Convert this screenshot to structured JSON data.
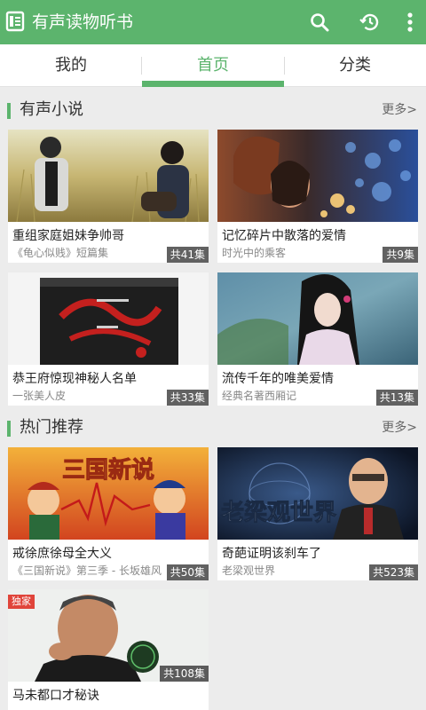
{
  "app": {
    "title": "有声读物听书"
  },
  "toolbar": {
    "icons": [
      "search-icon",
      "history-icon",
      "more-vert-icon"
    ]
  },
  "tabs": [
    {
      "label": "我的",
      "active": false
    },
    {
      "label": "首页",
      "active": true
    },
    {
      "label": "分类",
      "active": false
    }
  ],
  "sections": [
    {
      "title": "有声小说",
      "more": "更多>",
      "items": [
        {
          "title": "重组家庭姐妹争帅哥",
          "subtitle": "《龟心似贱》短篇集",
          "count": "共41集"
        },
        {
          "title": "记忆碎片中散落的爱情",
          "subtitle": "时光中的乘客",
          "count": "共9集"
        },
        {
          "title": "恭王府惊现神秘人名单",
          "subtitle": "一张美人皮",
          "count": "共33集"
        },
        {
          "title": "流传千年的唯美爱情",
          "subtitle": "经典名著西厢记",
          "count": "共13集"
        }
      ]
    },
    {
      "title": "热门推荐",
      "more": "更多>",
      "items": [
        {
          "title": "戒徐庶徐母全大义",
          "subtitle": "《三国新说》第三季 - 长坂雄风",
          "count": "共50集",
          "art": "三国新说"
        },
        {
          "title": "奇葩证明该刹车了",
          "subtitle": "老梁观世界",
          "count": "共523集",
          "art": "老梁观世界"
        },
        {
          "title": "马未都口才秘诀",
          "subtitle": "",
          "count": "共108集",
          "badge": "独家"
        }
      ]
    }
  ],
  "colors": {
    "primary": "#5cb46d",
    "background": "#ececec"
  }
}
